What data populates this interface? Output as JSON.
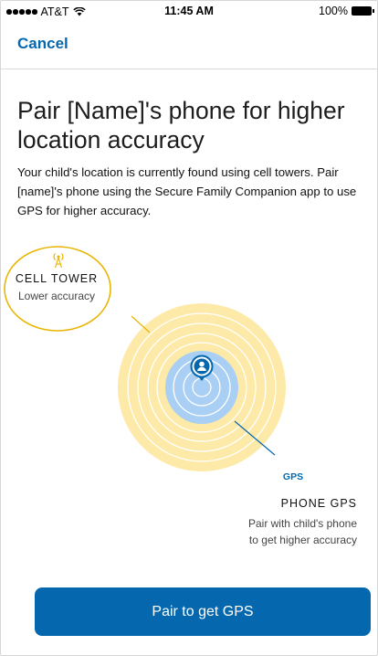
{
  "status_bar": {
    "carrier": "AT&T",
    "time": "11:45 AM",
    "battery": "100%"
  },
  "nav": {
    "cancel_label": "Cancel"
  },
  "content": {
    "title": "Pair [Name]'s phone for higher location accuracy",
    "description": "Your child's location is currently found using cell towers. Pair [name]'s phone using the Secure Family Companion app to use GPS for higher accuracy."
  },
  "diagram": {
    "cell_tower": {
      "label": "CELL TOWER",
      "sublabel": "Lower accuracy"
    },
    "gps": {
      "tag": "GPS",
      "label": "PHONE GPS",
      "sublabel_line1": "Pair with child's phone",
      "sublabel_line2": "to get higher accuracy"
    },
    "colors": {
      "cell_fill": "#fdeaa8",
      "cell_stroke": "#e9b500",
      "gps_fill": "#a9cff5",
      "accent": "#0568ae"
    }
  },
  "actions": {
    "pair_button_label": "Pair to get GPS"
  }
}
